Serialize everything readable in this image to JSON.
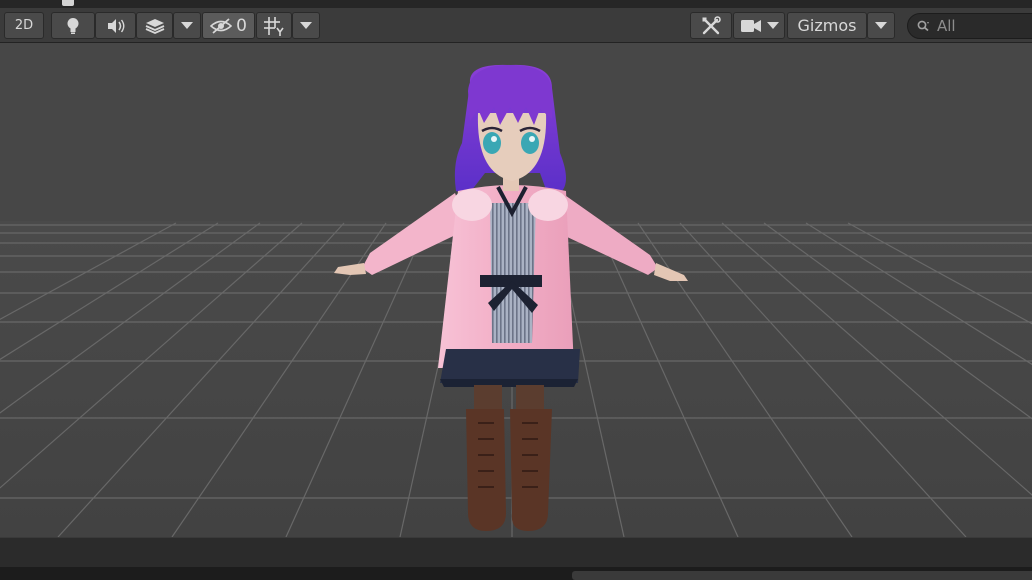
{
  "toolbar": {
    "mode_2d_label": "2D",
    "hidden_count": "0",
    "gizmos_label": "Gizmos",
    "search_placeholder": "All"
  },
  "icons": [
    "lightbulb-icon",
    "speaker-icon",
    "layers-icon",
    "chevron-down-icon",
    "eye-slash-icon",
    "grid-icon",
    "tools-icon",
    "camera-icon",
    "search-icon"
  ],
  "colors": {
    "toolbar_bg": "#3b3b3b",
    "viewport_bg": "#474747",
    "grid_line": "#6a6a6a",
    "hair": "#7a35c8",
    "coat": "#f4b6cc",
    "skirt": "#2a3248",
    "boots": "#5a3526"
  }
}
